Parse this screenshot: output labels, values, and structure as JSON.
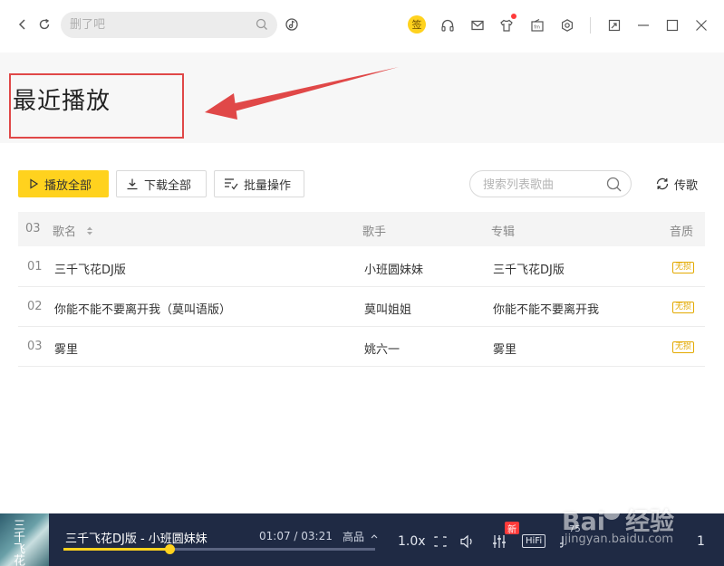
{
  "topbar": {
    "search_placeholder": "删了吧",
    "sign_badge": "签"
  },
  "header": {
    "title": "最近播放"
  },
  "actions": {
    "play_all": "播放全部",
    "download_all": "下载全部",
    "batch": "批量操作",
    "list_search_placeholder": "搜索列表歌曲",
    "upload": "传歌"
  },
  "table": {
    "count": "03",
    "columns": {
      "name": "歌名",
      "singer": "歌手",
      "album": "专辑",
      "quality": "音质"
    },
    "rows": [
      {
        "index": "01",
        "name": "三千飞花DJ版",
        "singer": "小班圆妹妹",
        "album": "三千飞花DJ版",
        "quality": "无损"
      },
      {
        "index": "02",
        "name": "你能不能不要离开我（莫叫语版）",
        "singer": "莫叫姐姐",
        "album": "你能不能不要离开我",
        "quality": "无损"
      },
      {
        "index": "03",
        "name": "雾里",
        "singer": "姚六一",
        "album": "雾里",
        "quality": "无损"
      }
    ]
  },
  "player": {
    "album_art_text": "三千飞花",
    "now_playing": "三千飞花DJ版 - 小班圆妹妹",
    "time": "01:07 / 03:21",
    "quality": "高品",
    "speed": "1.0x",
    "hifi": "HiFi",
    "new_badge": "新",
    "volume": "75",
    "playlist_count": "1",
    "progress": 0.34
  },
  "watermark": {
    "brand": "Bai",
    "tail": "经验",
    "url": "jingyan.baidu.com"
  },
  "colors": {
    "accent": "#ffd21e",
    "annotation": "#e04848",
    "player_bg": "#1f2a44"
  }
}
